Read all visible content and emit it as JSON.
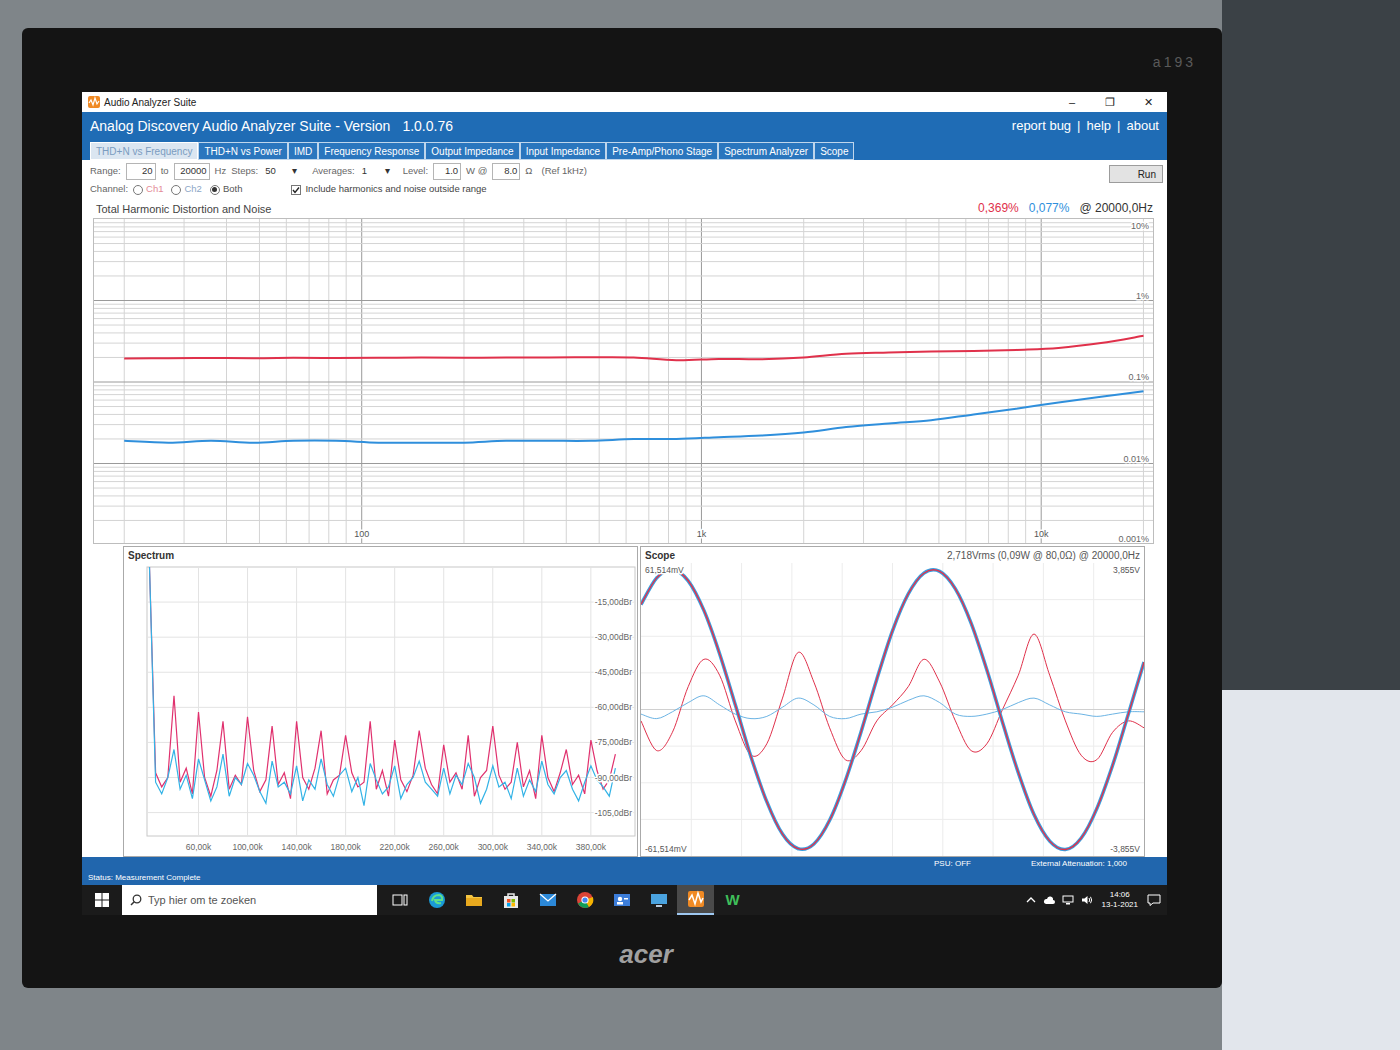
{
  "monitor": {
    "model": "a193",
    "brand": "acer"
  },
  "window": {
    "title": "Audio Analyzer Suite",
    "controls": [
      "–",
      "❐",
      "✕"
    ]
  },
  "header": {
    "title": "Analog Discovery Audio Analyzer Suite - Version",
    "version": "1.0.0.76",
    "links": [
      "report bug",
      "help",
      "about"
    ],
    "separator": "|"
  },
  "tabs": [
    {
      "label": "THD+N vs Frequency",
      "selected": true
    },
    {
      "label": "THD+N vs Power",
      "selected": false
    },
    {
      "label": "IMD",
      "selected": false
    },
    {
      "label": "Frequency Response",
      "selected": false
    },
    {
      "label": "Output Impedance",
      "selected": false
    },
    {
      "label": "Input Impedance",
      "selected": false
    },
    {
      "label": "Pre-Amp/Phono Stage",
      "selected": false
    },
    {
      "label": "Spectrum Analyzer",
      "selected": false
    },
    {
      "label": "Scope",
      "selected": false
    }
  ],
  "settings": {
    "range_label": "Range:",
    "range_from": "20",
    "to_label": "to",
    "range_to": "20000",
    "hz_label": "Hz",
    "steps_label": "Steps:",
    "steps": "50",
    "averages_label": "Averages:",
    "averages": "1",
    "dropdown_arrow": "▾",
    "level_label": "Level:",
    "level": "1.0",
    "w_at_label": "W @",
    "load": "8.0",
    "ohm_label": "Ω",
    "ref_label": "(Ref 1kHz)",
    "channel_label": "Channel:",
    "channels": [
      {
        "label": "Ch1",
        "selected": false,
        "color": "#e48a97"
      },
      {
        "label": "Ch2",
        "selected": false,
        "color": "#8ca6c6"
      },
      {
        "label": "Both",
        "selected": true,
        "color": "#555555"
      }
    ],
    "include": {
      "label": "Include harmonics and noise outside range",
      "checked": true
    },
    "run": "Run"
  },
  "thd_chart": {
    "title": "Total Harmonic Distortion and Noise",
    "at": "@ 20000,0Hz",
    "y_ticks": [
      {
        "label": "10%",
        "value": 10
      },
      {
        "label": "1%",
        "value": 1
      },
      {
        "label": "0.1%",
        "value": 0.1
      },
      {
        "label": "0.01%",
        "value": 0.01
      },
      {
        "label": "0.001%",
        "value": 0.001
      }
    ],
    "x_ticks": [
      {
        "label": "100",
        "value": 100
      },
      {
        "label": "1k",
        "value": 1000
      },
      {
        "label": "10k",
        "value": 10000
      }
    ],
    "frequencies": [
      20,
      27,
      36,
      48,
      63,
      84,
      112,
      150,
      200,
      266,
      356,
      474,
      632,
      843,
      1125,
      1500,
      2000,
      2667,
      3557,
      4743,
      6325,
      8434,
      11247,
      15000,
      20000
    ],
    "series": [
      {
        "color": "#e0314b",
        "reading": "0,369%",
        "values": [
          0.195,
          0.196,
          0.197,
          0.196,
          0.198,
          0.197,
          0.198,
          0.199,
          0.198,
          0.199,
          0.2,
          0.201,
          0.2,
          0.185,
          0.192,
          0.19,
          0.2,
          0.222,
          0.23,
          0.236,
          0.24,
          0.248,
          0.262,
          0.3,
          0.369
        ]
      },
      {
        "color": "#2f8fdc",
        "reading": "0,077%",
        "values": [
          0.019,
          0.018,
          0.019,
          0.018,
          0.019,
          0.019,
          0.018,
          0.018,
          0.018,
          0.019,
          0.019,
          0.019,
          0.02,
          0.02,
          0.021,
          0.022,
          0.024,
          0.028,
          0.031,
          0.034,
          0.04,
          0.047,
          0.056,
          0.066,
          0.077
        ]
      }
    ]
  },
  "spectrum": {
    "title": "Spectrum",
    "y_ticks": [
      {
        "label": "-15,00dBr",
        "value": -15
      },
      {
        "label": "-30,00dBr",
        "value": -30
      },
      {
        "label": "-45,00dBr",
        "value": -45
      },
      {
        "label": "-60,00dBr",
        "value": -60
      },
      {
        "label": "-75,00dBr",
        "value": -75
      },
      {
        "label": "-90,00dBr",
        "value": -90
      },
      {
        "label": "-105,0dBr",
        "value": -105
      }
    ],
    "x_ticks": [
      {
        "label": "60,00k",
        "value": 60
      },
      {
        "label": "100,00k",
        "value": 100
      },
      {
        "label": "140,00k",
        "value": 140
      },
      {
        "label": "180,00k",
        "value": 180
      },
      {
        "label": "220,00k",
        "value": 220
      },
      {
        "label": "260,00k",
        "value": 260
      },
      {
        "label": "300,00k",
        "value": 300
      },
      {
        "label": "340,00k",
        "value": 340
      },
      {
        "label": "380,00k",
        "value": 380
      }
    ],
    "start_khz": 20,
    "step_khz": 5,
    "series": [
      {
        "color": "#e0316e",
        "values": [
          0,
          -88,
          -94,
          -90,
          -55,
          -92,
          -86,
          -97,
          -62,
          -90,
          -98,
          -87,
          -66,
          -95,
          -89,
          -93,
          -64,
          -87,
          -96,
          -91,
          -68,
          -93,
          -88,
          -99,
          -66,
          -90,
          -95,
          -86,
          -70,
          -97,
          -91,
          -89,
          -72,
          -88,
          -94,
          -92,
          -66,
          -95,
          -87,
          -98,
          -74,
          -91,
          -96,
          -89,
          -70,
          -86,
          -93,
          -97,
          -76,
          -92,
          -88,
          -95,
          -72,
          -98,
          -90,
          -87,
          -68,
          -89,
          -95,
          -92,
          -75,
          -94,
          -87,
          -99,
          -72,
          -90,
          -96,
          -88,
          -78,
          -93,
          -89,
          -97,
          -74,
          -87,
          -95,
          -91,
          -80
        ]
      },
      {
        "color": "#33b3e6",
        "values": [
          0,
          -92,
          -97,
          -90,
          -78,
          -95,
          -89,
          -99,
          -82,
          -91,
          -100,
          -94,
          -80,
          -98,
          -90,
          -93,
          -84,
          -89,
          -96,
          -101,
          -83,
          -94,
          -92,
          -97,
          -85,
          -100,
          -91,
          -95,
          -82,
          -93,
          -98,
          -89,
          -86,
          -96,
          -90,
          -102,
          -84,
          -91,
          -97,
          -94,
          -85,
          -99,
          -93,
          -90,
          -83,
          -92,
          -95,
          -98,
          -86,
          -97,
          -89,
          -93,
          -84,
          -90,
          -101,
          -95,
          -85,
          -94,
          -92,
          -99,
          -86,
          -98,
          -91,
          -96,
          -83,
          -93,
          -97,
          -90,
          -87,
          -95,
          -100,
          -92,
          -85,
          -91,
          -94,
          -98,
          -86
        ]
      }
    ]
  },
  "scope": {
    "title": "Scope",
    "summary": "2,718Vrms (0,09W @ 80,0Ω) @ 20000,0Hz",
    "residual_max": "61,514mV",
    "residual_min": "-61,514mV",
    "signal_max": "3,855V",
    "signal_min": "-3,855V",
    "signal_range": 3.855,
    "residual_range": 61.514,
    "signals": [
      {
        "color": "#3aa0e0",
        "values": [
          2.88,
          3.61,
          3.84,
          3.53,
          2.72,
          1.53,
          0.13,
          -1.3,
          -2.53,
          -3.42,
          -3.82,
          -3.69,
          -3.04,
          -1.96,
          -0.61,
          0.83,
          2.16,
          3.17,
          3.74,
          3.79,
          3.31,
          2.37,
          1.09,
          -0.35,
          -1.73,
          -2.88,
          -3.61,
          -3.84,
          -3.53,
          -2.72,
          -1.53,
          -0.13,
          1.3
        ]
      },
      {
        "color": "#e0314b",
        "values": [
          2.88,
          3.61,
          3.84,
          3.53,
          2.72,
          1.53,
          0.13,
          -1.3,
          -2.53,
          -3.42,
          -3.82,
          -3.69,
          -3.04,
          -1.96,
          -0.61,
          0.83,
          2.16,
          3.17,
          3.74,
          3.79,
          3.31,
          2.37,
          1.09,
          -0.35,
          -1.73,
          -2.88,
          -3.61,
          -3.84,
          -3.53,
          -2.72,
          -1.53,
          -0.13,
          1.3
        ]
      }
    ],
    "residuals": [
      {
        "color": "#e0314b",
        "values": [
          -5,
          -18,
          -10,
          10,
          22,
          15,
          -5,
          -20,
          -15,
          5,
          25,
          12,
          -8,
          -22,
          -18,
          -5,
          2,
          10,
          22,
          12,
          -5,
          -18,
          -15,
          0,
          15,
          33,
          15,
          -5,
          -20,
          -22,
          -10,
          -5,
          -8
        ]
      },
      {
        "color": "#6cb4e4",
        "values": [
          -2,
          -4,
          -1,
          3,
          6,
          2,
          -2,
          -4,
          -3,
          1,
          5,
          2,
          -3,
          -4,
          -2,
          -1,
          1,
          4,
          6,
          3,
          -2,
          -3,
          -2,
          0,
          3,
          5,
          2,
          -1,
          -2,
          -3,
          -2,
          -1,
          -1
        ]
      }
    ]
  },
  "info_bar": {
    "psu": "PSU: OFF",
    "attenuation": "External Attenuation: 1,000"
  },
  "status_bar": {
    "text": "Status: Measurement Complete"
  },
  "taskbar": {
    "search": {
      "placeholder": "Typ hier om te zoeken"
    },
    "apps": [
      {
        "kind": "taskview",
        "selected": false
      },
      {
        "kind": "edge",
        "selected": false
      },
      {
        "kind": "explorer",
        "selected": false
      },
      {
        "kind": "store",
        "selected": false
      },
      {
        "kind": "mail",
        "selected": false
      },
      {
        "kind": "chrome",
        "selected": false
      },
      {
        "kind": "people",
        "selected": false
      },
      {
        "kind": "monitor",
        "selected": false
      },
      {
        "kind": "analyzer",
        "selected": true
      },
      {
        "kind": "letter",
        "label": "W",
        "selected": false
      }
    ],
    "time": "14:06",
    "date": "13-1-2021"
  }
}
